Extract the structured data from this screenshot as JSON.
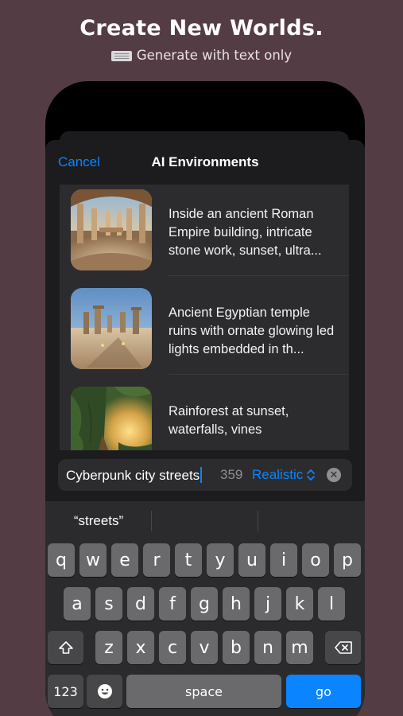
{
  "promo": {
    "headline": "Create New Worlds.",
    "subline": "Generate with text only",
    "subline_icon": "keyboard-icon"
  },
  "nav": {
    "cancel": "Cancel",
    "title": "AI Environments"
  },
  "environments": [
    {
      "description": "Inside an ancient Roman Empire building, intricate stone work, sunset, ultra..."
    },
    {
      "description": "Ancient Egyptian temple ruins with ornate glowing led lights embedded in th..."
    },
    {
      "description": "Rainforest at sunset, waterfalls, vines"
    }
  ],
  "prompt_input": {
    "value": "Cyberpunk city streets",
    "remaining_chars": "359",
    "style": "Realistic",
    "style_icon": "chevron-up-down-icon",
    "clear_icon": "clear-x-icon"
  },
  "keyboard": {
    "suggestions": [
      "“streets”",
      "",
      ""
    ],
    "row1": [
      "q",
      "w",
      "e",
      "r",
      "t",
      "y",
      "u",
      "i",
      "o",
      "p"
    ],
    "row2": [
      "a",
      "s",
      "d",
      "f",
      "g",
      "h",
      "j",
      "k",
      "l"
    ],
    "row3": [
      "z",
      "x",
      "c",
      "v",
      "b",
      "n",
      "m"
    ],
    "shift_icon": "shift-icon",
    "delete_icon": "backspace-icon",
    "numbers_label": "123",
    "emoji_icon": "emoji-icon",
    "space_label": "space",
    "go_label": "go"
  },
  "colors": {
    "background": "#543c44",
    "accent": "#0a84ff",
    "sheet": "#1c1c1e"
  }
}
